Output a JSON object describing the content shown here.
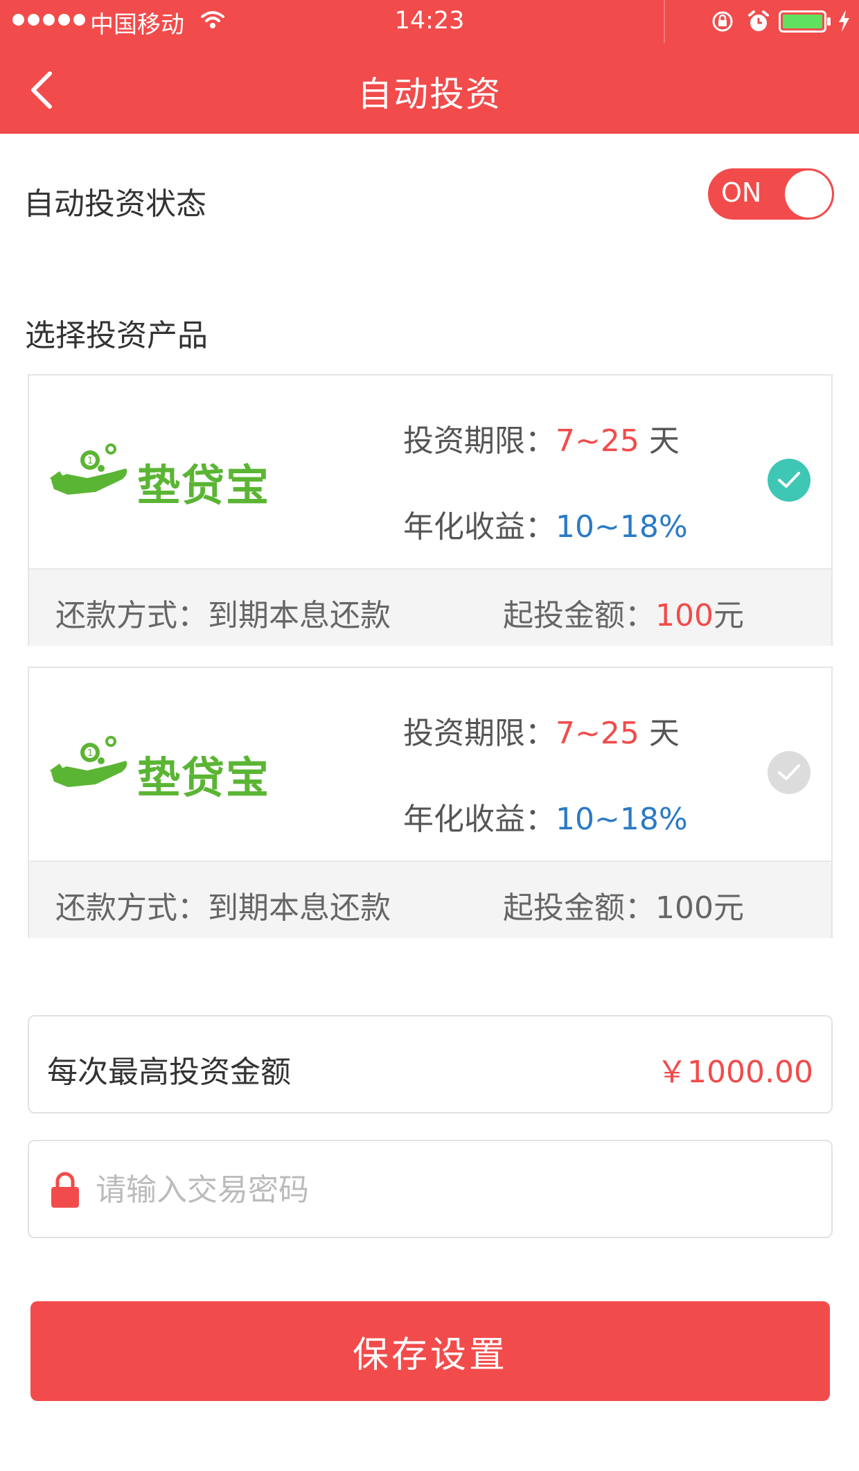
{
  "status_bar": {
    "carrier": "中国移动",
    "time": "14:23"
  },
  "nav": {
    "title": "自动投资"
  },
  "auto_invest": {
    "label": "自动投资状态",
    "toggle_text": "ON",
    "enabled": true
  },
  "products_section": {
    "title": "选择投资产品"
  },
  "products": [
    {
      "logo_text": "垫贷宝",
      "term_label": "投资期限：",
      "term_value": "7~25",
      "term_unit": " 天",
      "yield_label": "年化收益：",
      "yield_value": "10~18%",
      "repay_label": "还款方式：",
      "repay_value": "到期本息还款",
      "min_label": "起投金额：",
      "min_value": "100",
      "min_unit": "元",
      "selected": true
    },
    {
      "logo_text": "垫贷宝",
      "term_label": "投资期限：",
      "term_value": "7~25",
      "term_unit": " 天",
      "yield_label": "年化收益：",
      "yield_value": "10~18%",
      "repay_label": "还款方式：",
      "repay_value": "到期本息还款",
      "min_label": "起投金额：",
      "min_value": "100元",
      "selected": false
    }
  ],
  "max_amount": {
    "label": "每次最高投资金额",
    "value": "￥1000.00"
  },
  "password": {
    "placeholder": "请输入交易密码"
  },
  "save_button": {
    "label": "保存设置"
  },
  "colors": {
    "brand_red": "#f24b4b",
    "check_on": "#3fc7b5",
    "check_off": "#dcdcdc",
    "yield_blue": "#2b7ac5",
    "logo_green": "#5bb534"
  }
}
